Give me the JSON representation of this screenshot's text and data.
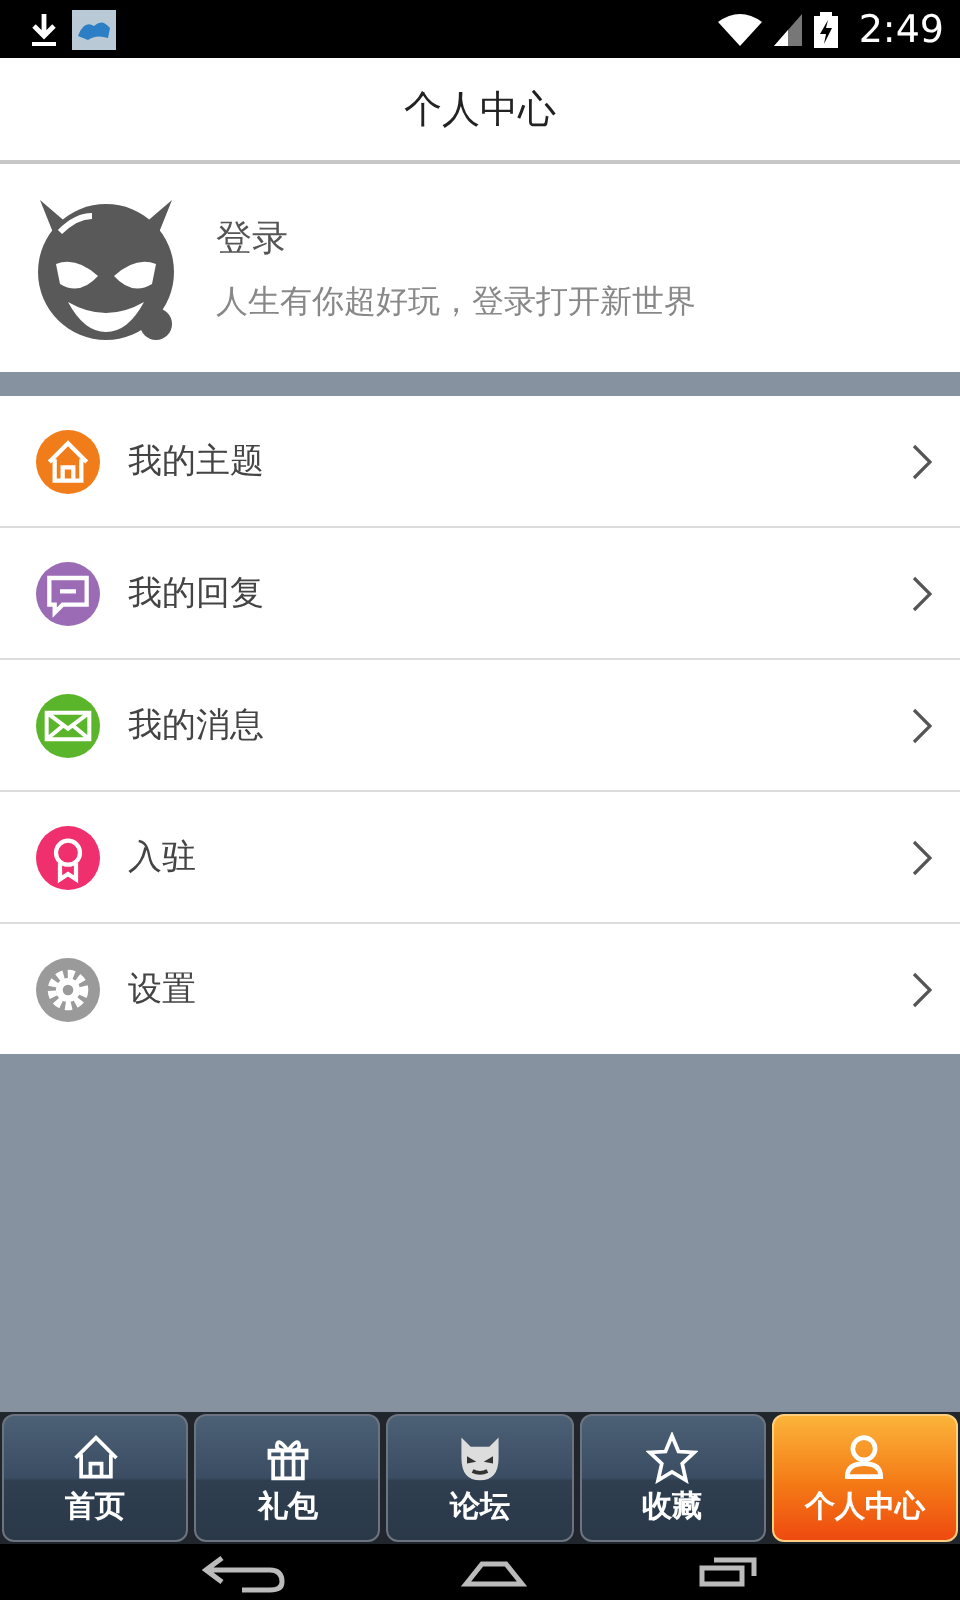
{
  "status_bar": {
    "time": "2:49"
  },
  "header": {
    "title": "个人中心"
  },
  "profile": {
    "name": "登录",
    "tagline": "人生有你超好玩，登录打开新世界"
  },
  "menu": [
    {
      "label": "我的主题",
      "color": "#f07d1a"
    },
    {
      "label": "我的回复",
      "color": "#9b6bb5"
    },
    {
      "label": "我的消息",
      "color": "#5bb52a"
    },
    {
      "label": "入驻",
      "color": "#f0306e"
    },
    {
      "label": "设置",
      "color": "#9a9a9a"
    }
  ],
  "tabs": [
    {
      "label": "首页",
      "selected": false
    },
    {
      "label": "礼包",
      "selected": false
    },
    {
      "label": "论坛",
      "selected": false
    },
    {
      "label": "收藏",
      "selected": false
    },
    {
      "label": "个人中心",
      "selected": true
    }
  ]
}
